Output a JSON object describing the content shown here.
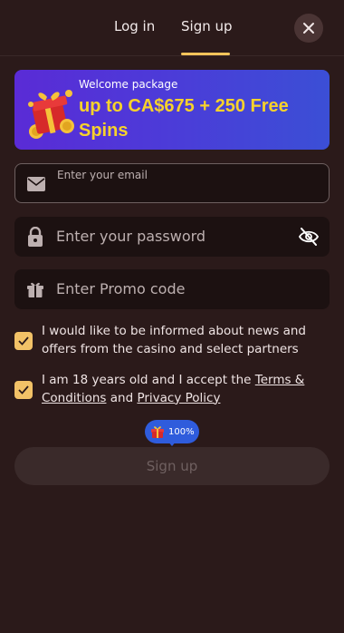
{
  "tabs": {
    "login": "Log in",
    "signup": "Sign up",
    "active": "signup"
  },
  "banner": {
    "subtitle": "Welcome package",
    "title": "up to CA$675 + 250 Free Spins"
  },
  "form": {
    "email": {
      "label": "Enter your email",
      "value": ""
    },
    "password": {
      "placeholder": "Enter your password",
      "value": ""
    },
    "promo": {
      "placeholder": "Enter Promo code",
      "value": ""
    }
  },
  "consents": {
    "news": {
      "text": "I would like to be informed about news and offers from the casino and select partners",
      "checked": true
    },
    "age": {
      "text_before": "I am 18 years old and I accept the ",
      "terms_link": "Terms & Conditions",
      "text_middle": " and ",
      "privacy_link": "Privacy Policy",
      "checked": true
    }
  },
  "progress": {
    "label": "100%",
    "value": 100
  },
  "submit": {
    "label": "Sign up",
    "enabled": false
  },
  "icons": {
    "close": "close-icon",
    "banner": "gift-box-icon",
    "email": "envelope-icon",
    "password": "lock-icon",
    "visibility": "eye-off-icon",
    "promo": "gift-icon",
    "check": "checkmark-icon"
  },
  "colors": {
    "background": "#2b1a1a",
    "accent": "#f5c45b",
    "banner_title": "#f7d22b",
    "banner_gradient_start": "#5a2bd6",
    "banner_gradient_end": "#3b4fd6",
    "progress_badge": "#2f5cdc"
  }
}
